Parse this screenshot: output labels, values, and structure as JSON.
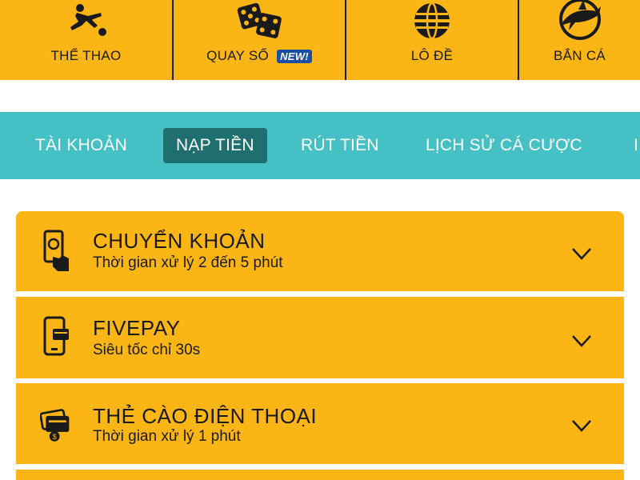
{
  "categories": [
    {
      "label": "THỂ THAO",
      "icon": "soccer-player-icon"
    },
    {
      "label": "QUAY SỐ",
      "icon": "dice-icon",
      "badge": "NEW!"
    },
    {
      "label": "LÔ ĐỀ",
      "icon": "lottery-ball-icon"
    },
    {
      "label": "BẮN CÁ",
      "icon": "shark-icon"
    }
  ],
  "tabs": [
    {
      "label": "TÀI KHOẢN",
      "active": false
    },
    {
      "label": "NẠP TIỀN",
      "active": true
    },
    {
      "label": "RÚT TIỀN",
      "active": false
    },
    {
      "label": "LỊCH SỬ CÁ CƯỢC",
      "active": false
    },
    {
      "label": "I",
      "active": false
    }
  ],
  "methods": [
    {
      "title": "CHUYỂN KHOẢN",
      "subtitle": "Thời gian xử lý 2 đến 5 phút",
      "icon": "mobile-transfer-icon"
    },
    {
      "title": "FIVEPAY",
      "subtitle": "Siêu tốc chỉ 30s",
      "icon": "mobile-card-icon"
    },
    {
      "title": "THẺ CÀO ĐIỆN THOẠI",
      "subtitle": "Thời gian xử lý 1 phút",
      "icon": "scratch-card-icon"
    }
  ],
  "colors": {
    "accent": "#fbb616",
    "tab_bar": "#45c0c4",
    "tab_active": "#1f6f71",
    "badge": "#1c4fa1"
  }
}
